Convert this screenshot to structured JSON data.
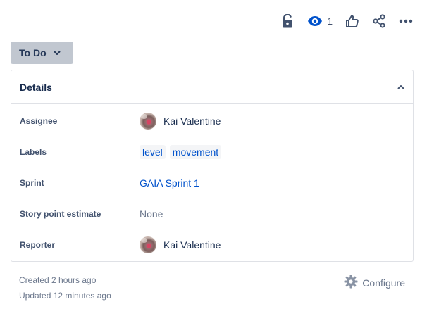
{
  "actions": {
    "lock": "unlock-icon",
    "watch": {
      "icon": "eye-icon",
      "count": "1"
    },
    "like": "thumbs-up-icon",
    "share": "share-icon",
    "more": "more-icon"
  },
  "status": {
    "label": "To Do"
  },
  "details": {
    "title": "Details",
    "fields": {
      "assignee": {
        "label": "Assignee",
        "name": "Kai Valentine"
      },
      "labels": {
        "label": "Labels",
        "items": [
          "level",
          "movement"
        ]
      },
      "sprint": {
        "label": "Sprint",
        "value": "GAIA Sprint 1"
      },
      "story_points": {
        "label": "Story point estimate",
        "value": "None"
      },
      "reporter": {
        "label": "Reporter",
        "name": "Kai Valentine"
      }
    }
  },
  "footer": {
    "created": "Created 2 hours ago",
    "updated": "Updated 12 minutes ago",
    "configure": "Configure"
  },
  "colors": {
    "status_bg": "#c1c7d0",
    "link": "#0052cc",
    "watch": "#0052cc",
    "icon": "#42526e",
    "border": "#dfe1e6"
  }
}
